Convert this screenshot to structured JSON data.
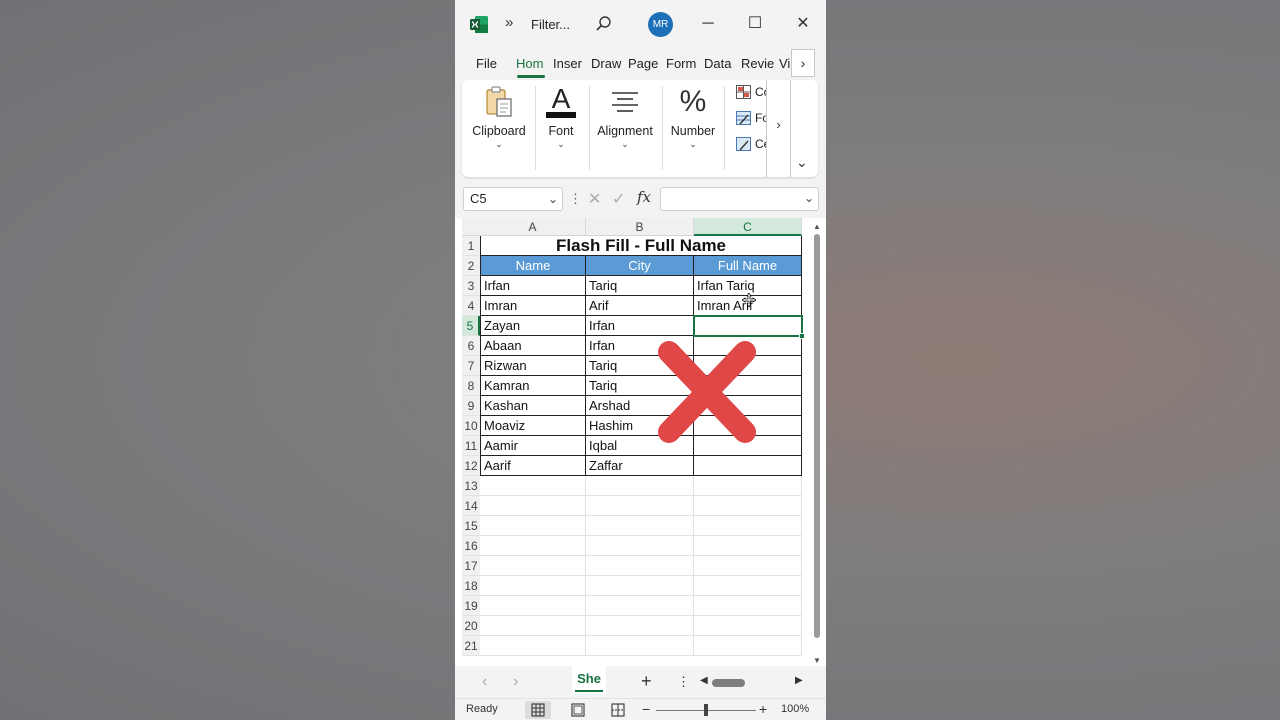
{
  "app": {
    "title": "Filter...",
    "more_label": "»",
    "avatar_initials": "MR",
    "window_controls": {
      "minimize": "─",
      "maximize": "☐",
      "close": "✕"
    }
  },
  "tabs": {
    "items": [
      "File",
      "Hom",
      "Inser",
      "Draw",
      "Page",
      "Form",
      "Data",
      "Revie",
      "Vi"
    ],
    "active": "Hom",
    "scroll_label": "›"
  },
  "ribbon": {
    "groups": [
      {
        "label": "Clipboard",
        "icon": "clipboard-icon"
      },
      {
        "label": "Font",
        "icon": "font-icon"
      },
      {
        "label": "Alignment",
        "icon": "alignment-icon"
      },
      {
        "label": "Number",
        "icon": "number-icon"
      }
    ],
    "number_symbol": "%",
    "font_glyph": "A",
    "styles_items": [
      "Co",
      "Fo",
      "Ce"
    ],
    "overflow_label": "›",
    "expand_label": "⌄",
    "caret": "⌄"
  },
  "formula_bar": {
    "name_box": "C5",
    "dropdown": "⌄",
    "dots": "⋮",
    "cancel": "✕",
    "enter": "✓",
    "fx": "fx",
    "value": ""
  },
  "sheet": {
    "columns": [
      "A",
      "B",
      "C"
    ],
    "selected_column": "C",
    "title": "Flash Fill - Full Name",
    "headers": [
      "Name",
      "City",
      "Full Name"
    ],
    "rows": [
      [
        "Irfan",
        "Tariq",
        "Irfan Tariq"
      ],
      [
        "Imran",
        "Arif",
        "Imran Arif"
      ],
      [
        "Zayan",
        "Irfan",
        ""
      ],
      [
        "Abaan",
        "Irfan",
        ""
      ],
      [
        "Rizwan",
        "Tariq",
        ""
      ],
      [
        "Kamran",
        "Tariq",
        ""
      ],
      [
        "Kashan",
        "Arshad",
        ""
      ],
      [
        "Moaviz",
        "Hashim",
        ""
      ],
      [
        "Aamir",
        "Iqbal",
        ""
      ],
      [
        "Aarif",
        "Zaffar",
        ""
      ]
    ],
    "row_numbers": [
      "1",
      "2",
      "3",
      "4",
      "5",
      "6",
      "7",
      "8",
      "9",
      "10",
      "11",
      "12",
      "13",
      "14",
      "15",
      "16",
      "17",
      "18",
      "19",
      "20",
      "21"
    ],
    "active_row": "5",
    "overlay_icon": "red-x-icon",
    "overlay_color": "#e04848"
  },
  "sheet_tabs": {
    "prev": "‹",
    "next": "›",
    "active_tab": "She",
    "add": "+",
    "more": "⋮",
    "scroll_left": "◀",
    "scroll_right": "▶"
  },
  "status_bar": {
    "status": "Ready",
    "zoom_minus": "−",
    "zoom_plus": "+",
    "zoom_level": "100%",
    "zoom_fraction": 0.5
  },
  "colors": {
    "accent": "#1a7343",
    "header_fill": "#5b9bd5",
    "avatar": "#1d6fb8"
  }
}
